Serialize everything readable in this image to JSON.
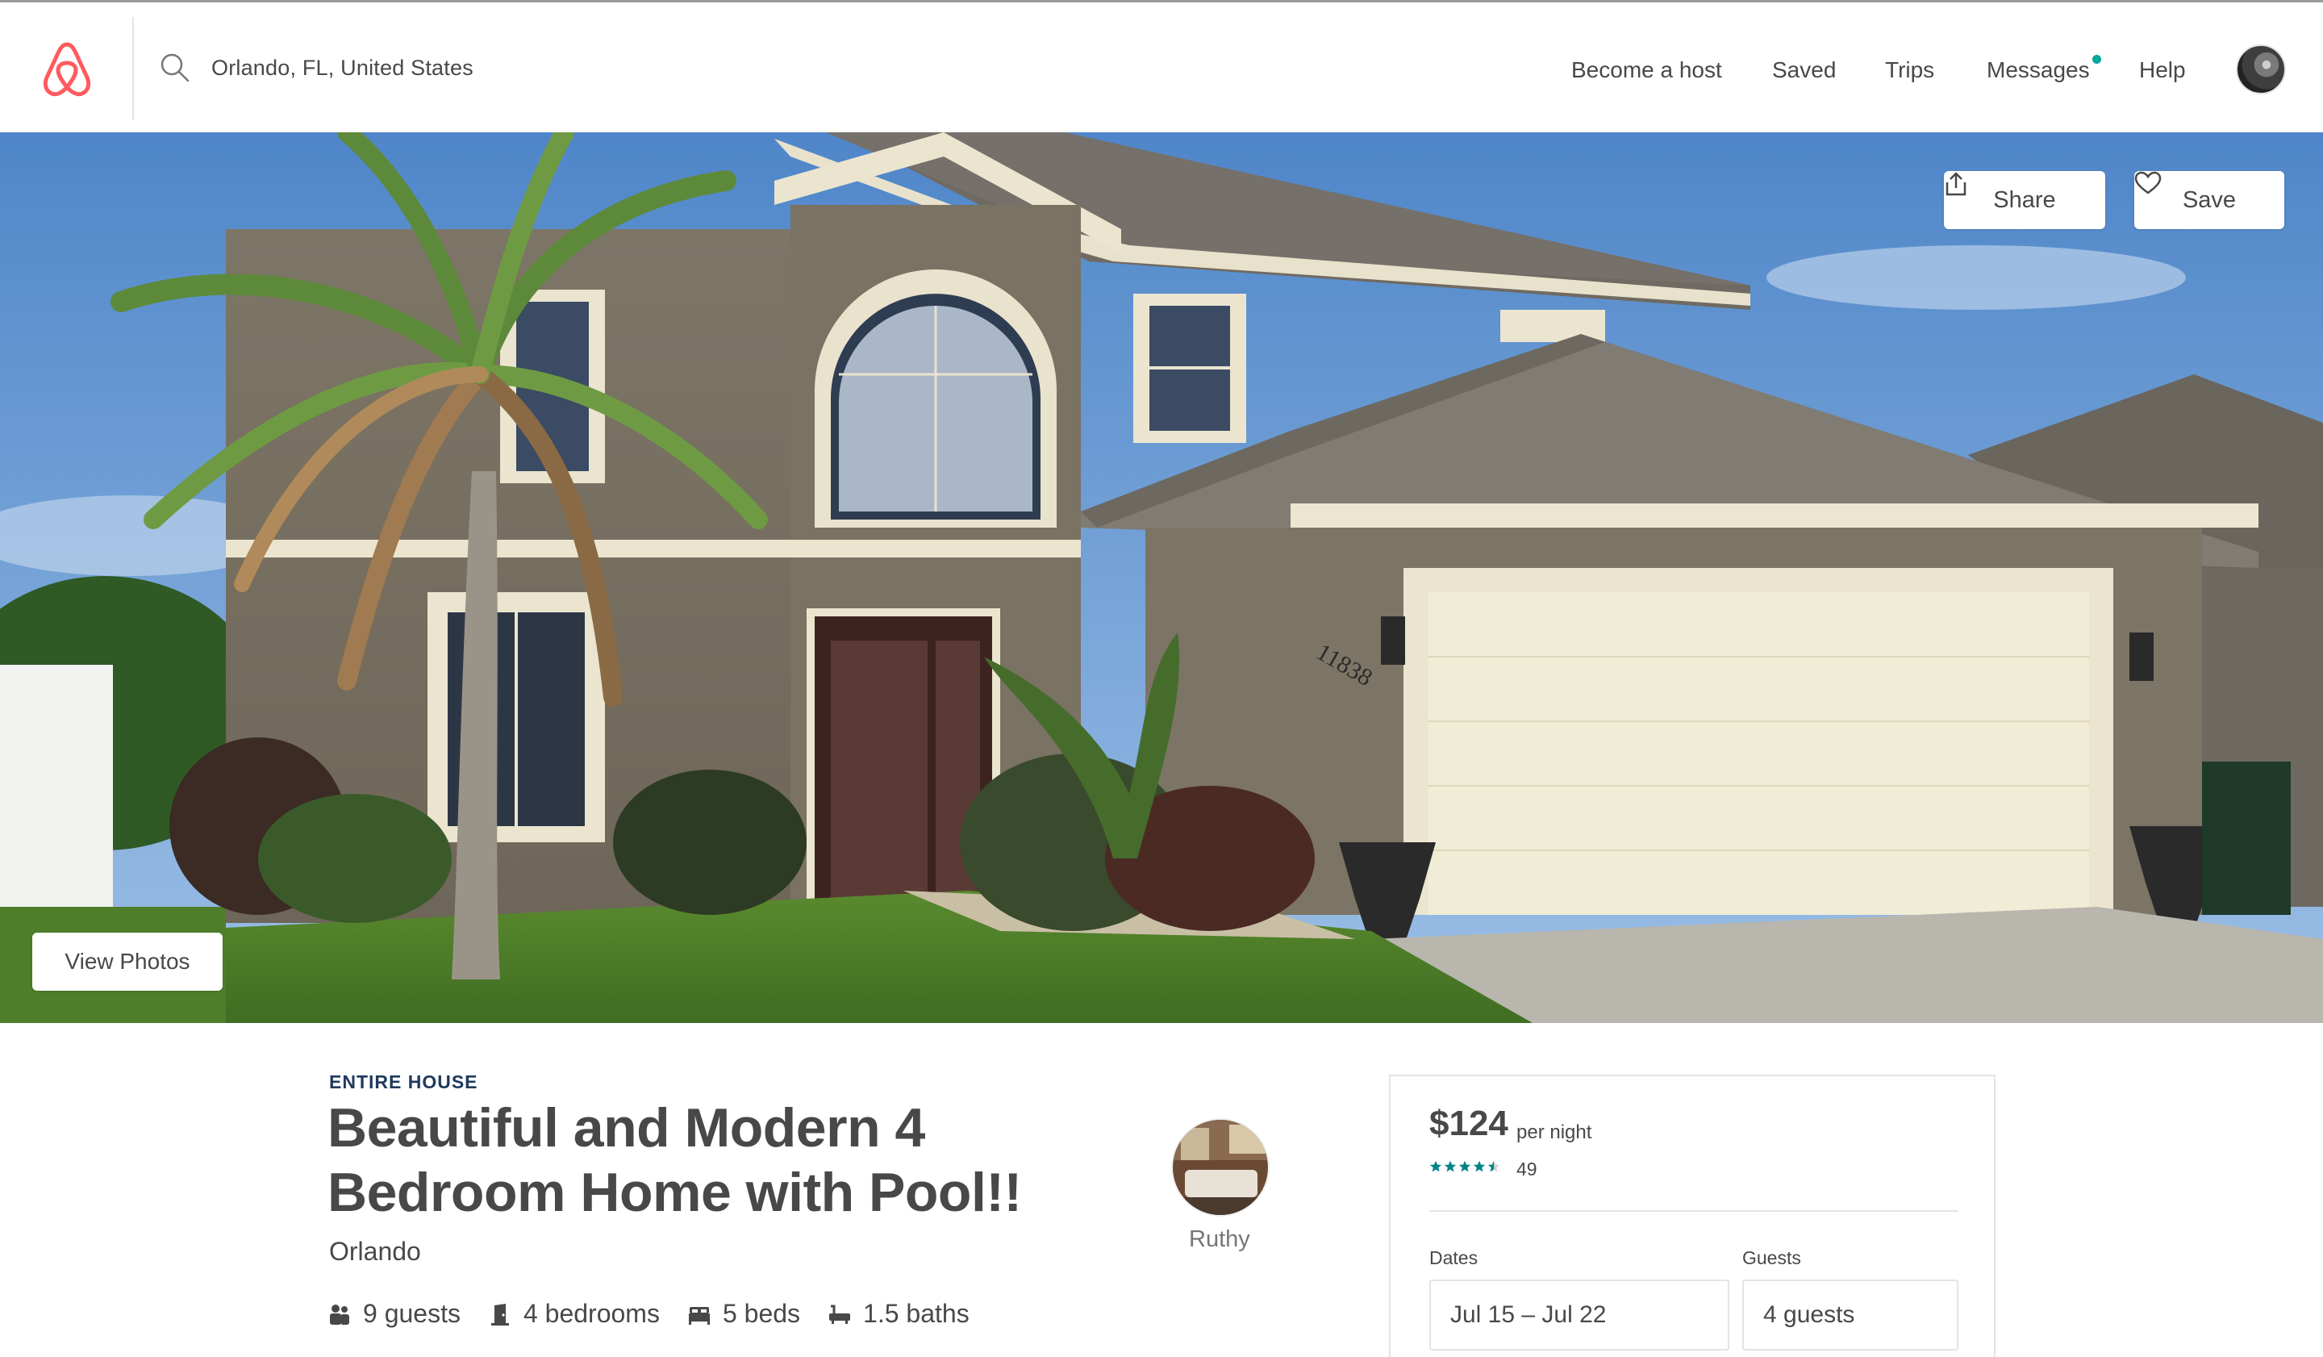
{
  "header": {
    "logo_icon": "airbnb-belo-logo",
    "search_icon": "search-icon",
    "search_location": "Orlando, FL, United States",
    "nav": {
      "become_host": "Become a host",
      "saved": "Saved",
      "trips": "Trips",
      "messages": "Messages",
      "help": "Help"
    },
    "messages_badge_color": "#00a699"
  },
  "hero": {
    "share_label": "Share",
    "share_icon": "share-icon",
    "save_label": "Save",
    "save_icon": "heart-icon",
    "view_photos_label": "View Photos",
    "house_number": "11838"
  },
  "listing": {
    "kind": "ENTIRE HOUSE",
    "title_line1": "Beautiful and Modern 4",
    "title_line2": "Bedroom Home with Pool!!",
    "city": "Orlando",
    "amenities": [
      {
        "icon": "guests-icon",
        "label": "9 guests"
      },
      {
        "icon": "bedroom-icon",
        "label": "4 bedrooms"
      },
      {
        "icon": "bed-icon",
        "label": "5 beds"
      },
      {
        "icon": "bath-icon",
        "label": "1.5 baths"
      }
    ],
    "host_name": "Ruthy"
  },
  "booking": {
    "price": "$124",
    "per_night": "per night",
    "rating_stars": 4.5,
    "review_count": "49",
    "star_color": "#008489",
    "dates_label": "Dates",
    "dates_value": "Jul 15  –  Jul 22",
    "guests_label": "Guests",
    "guests_value": "4 guests"
  }
}
